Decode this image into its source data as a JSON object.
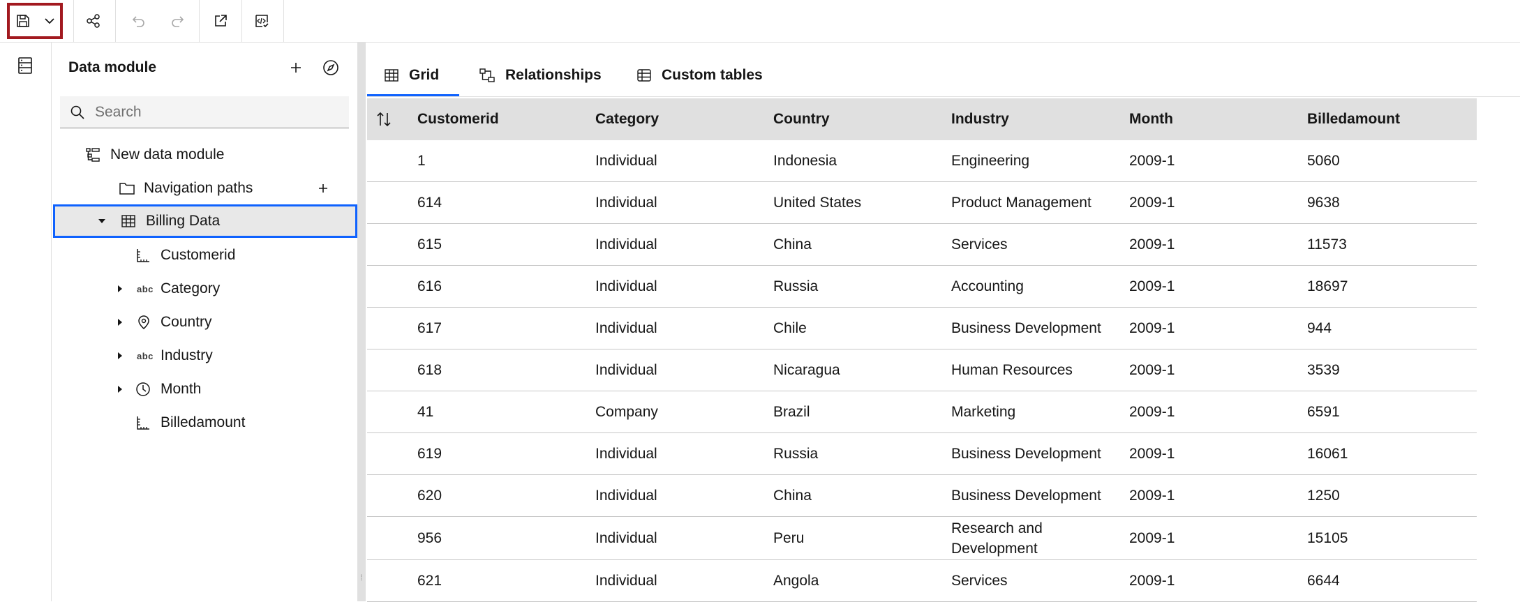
{
  "toolbar": {
    "buttons": [
      "save-icon",
      "chevron-down-icon",
      "share-icon",
      "undo-icon",
      "redo-icon",
      "launch-icon",
      "code-validate-icon"
    ],
    "highlight_color": "#a2191f"
  },
  "panel": {
    "title": "Data module",
    "search_placeholder": "Search",
    "tree": [
      {
        "label": "New data module",
        "icon": "data-module-icon"
      },
      {
        "label": "Navigation paths",
        "icon": "folder-icon"
      },
      {
        "label": "Billing Data",
        "icon": "table-icon",
        "expanded": true,
        "selected": true
      },
      {
        "label": "Customerid",
        "icon": "measure-icon"
      },
      {
        "label": "Category",
        "icon": "abc-icon",
        "icon_text": "abc"
      },
      {
        "label": "Country",
        "icon": "location-icon"
      },
      {
        "label": "Industry",
        "icon": "abc-icon",
        "icon_text": "abc"
      },
      {
        "label": "Month",
        "icon": "time-icon"
      },
      {
        "label": "Billedamount",
        "icon": "measure-icon"
      }
    ]
  },
  "tabs": [
    {
      "label": "Grid",
      "active": true
    },
    {
      "label": "Relationships",
      "active": false
    },
    {
      "label": "Custom tables",
      "active": false
    }
  ],
  "grid": {
    "columns": [
      "Customerid",
      "Category",
      "Country",
      "Industry",
      "Month",
      "Billedamount"
    ],
    "rows": [
      [
        "1",
        "Individual",
        "Indonesia",
        "Engineering",
        "2009-1",
        "5060"
      ],
      [
        "614",
        "Individual",
        "United States",
        "Product Management",
        "2009-1",
        "9638"
      ],
      [
        "615",
        "Individual",
        "China",
        "Services",
        "2009-1",
        "11573"
      ],
      [
        "616",
        "Individual",
        "Russia",
        "Accounting",
        "2009-1",
        "18697"
      ],
      [
        "617",
        "Individual",
        "Chile",
        "Business Development",
        "2009-1",
        "944"
      ],
      [
        "618",
        "Individual",
        "Nicaragua",
        "Human Resources",
        "2009-1",
        "3539"
      ],
      [
        "41",
        "Company",
        "Brazil",
        "Marketing",
        "2009-1",
        "6591"
      ],
      [
        "619",
        "Individual",
        "Russia",
        "Business Development",
        "2009-1",
        "16061"
      ],
      [
        "620",
        "Individual",
        "China",
        "Business Development",
        "2009-1",
        "1250"
      ],
      [
        "956",
        "Individual",
        "Peru",
        "Research and Development",
        "2009-1",
        "15105"
      ],
      [
        "621",
        "Individual",
        "Angola",
        "Services",
        "2009-1",
        "6644"
      ]
    ]
  },
  "colors": {
    "accent": "#0f62fe",
    "header_bg": "#e0e0e0"
  }
}
